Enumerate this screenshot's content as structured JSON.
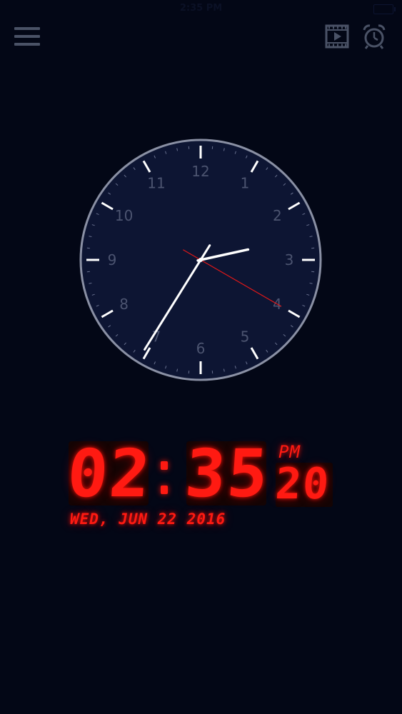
{
  "status_bar": {
    "time": "2:35 PM"
  },
  "toolbar": {
    "menu_icon": "hamburger-menu-icon",
    "video_icon": "film-play-icon",
    "alarm_icon": "alarm-clock-icon"
  },
  "analog_clock": {
    "numerals": [
      "12",
      "1",
      "2",
      "3",
      "4",
      "5",
      "6",
      "7",
      "8",
      "9",
      "10",
      "11"
    ],
    "time": {
      "hours": 2,
      "minutes": 35,
      "seconds": 20
    },
    "colors": {
      "face": "#0d1533",
      "rim": "#8a90a4",
      "numerals": "#4c5470",
      "hands": "#ffffff",
      "second_hand": "#e01818"
    }
  },
  "digital_clock": {
    "hours": "02",
    "minutes": "35",
    "ampm": "PM",
    "seconds": "20",
    "date": "WED, JUN 22 2016",
    "color": "#ff1a12"
  }
}
